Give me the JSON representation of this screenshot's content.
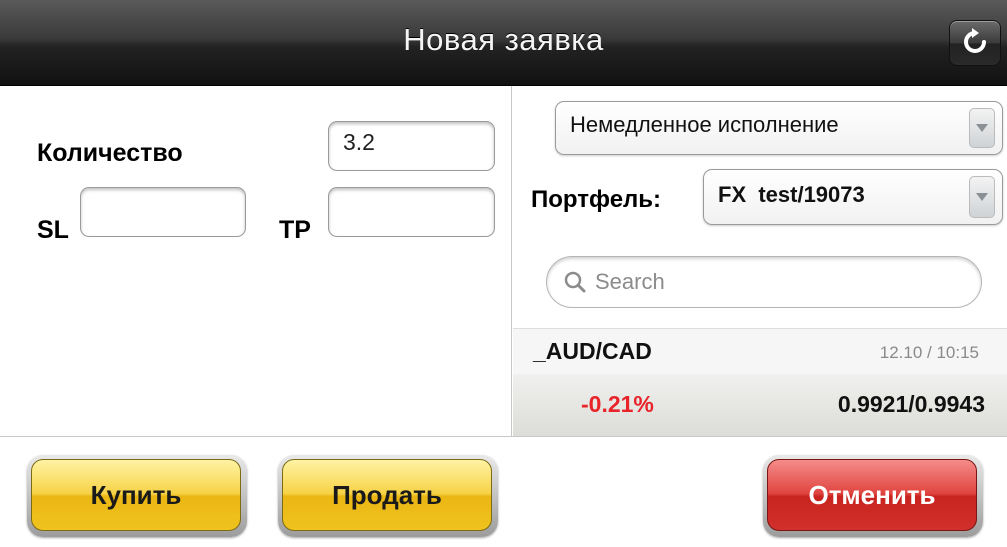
{
  "window": {
    "title": "Новая заявка"
  },
  "titlebar": {
    "refresh_icon": "refresh-icon"
  },
  "order_form": {
    "quantity_label": "Количество",
    "quantity_value": "3.2",
    "sl_label": "SL",
    "sl_value": "",
    "tp_label": "TP",
    "tp_value": ""
  },
  "execution": {
    "selected": "Немедленное исполнение"
  },
  "portfolio": {
    "label": "Портфель:",
    "selected": "FX  test/19073"
  },
  "search": {
    "placeholder": "Search",
    "icon": "search-icon"
  },
  "instrument": {
    "symbol": "_AUD/CAD",
    "timestamp": "12.10 / 10:15",
    "change": "-0.21%",
    "bid_ask": "0.9921/0.9943",
    "change_color": "#e8232a"
  },
  "actions": {
    "buy_label": "Купить",
    "sell_label": "Продать",
    "cancel_label": "Отменить"
  },
  "colors": {
    "buy_sell_accent": "#f0c31e",
    "cancel_accent": "#d2302c",
    "titlebar": "#222222"
  }
}
